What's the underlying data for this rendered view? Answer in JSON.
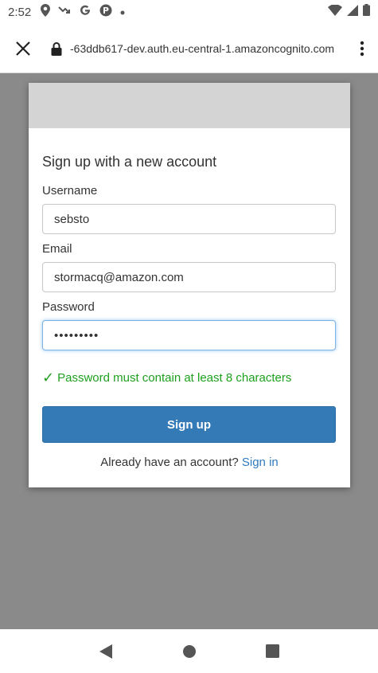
{
  "status_bar": {
    "time": "2:52",
    "left_icons": [
      "location-icon",
      "missed-call-icon",
      "google-icon",
      "app-icon",
      "dot-icon"
    ],
    "right_icons": [
      "wifi-icon",
      "signal-icon",
      "battery-icon"
    ]
  },
  "browser": {
    "url": "-63ddb617-dev.auth.eu-central-1.amazoncognito.com"
  },
  "form": {
    "title": "Sign up with a new account",
    "username_label": "Username",
    "username_value": "sebsto",
    "email_label": "Email",
    "email_value": "stormacq@amazon.com",
    "password_label": "Password",
    "password_value": "•••••••••",
    "validation_check": "✓",
    "validation_message": "Password must contain at least 8 characters",
    "signup_button": "Sign up",
    "signin_prompt": "Already have an account?",
    "signin_link": "Sign in"
  },
  "colors": {
    "primary_button": "#337ab7",
    "success": "#1ea01e",
    "link": "#2f7bbf"
  }
}
